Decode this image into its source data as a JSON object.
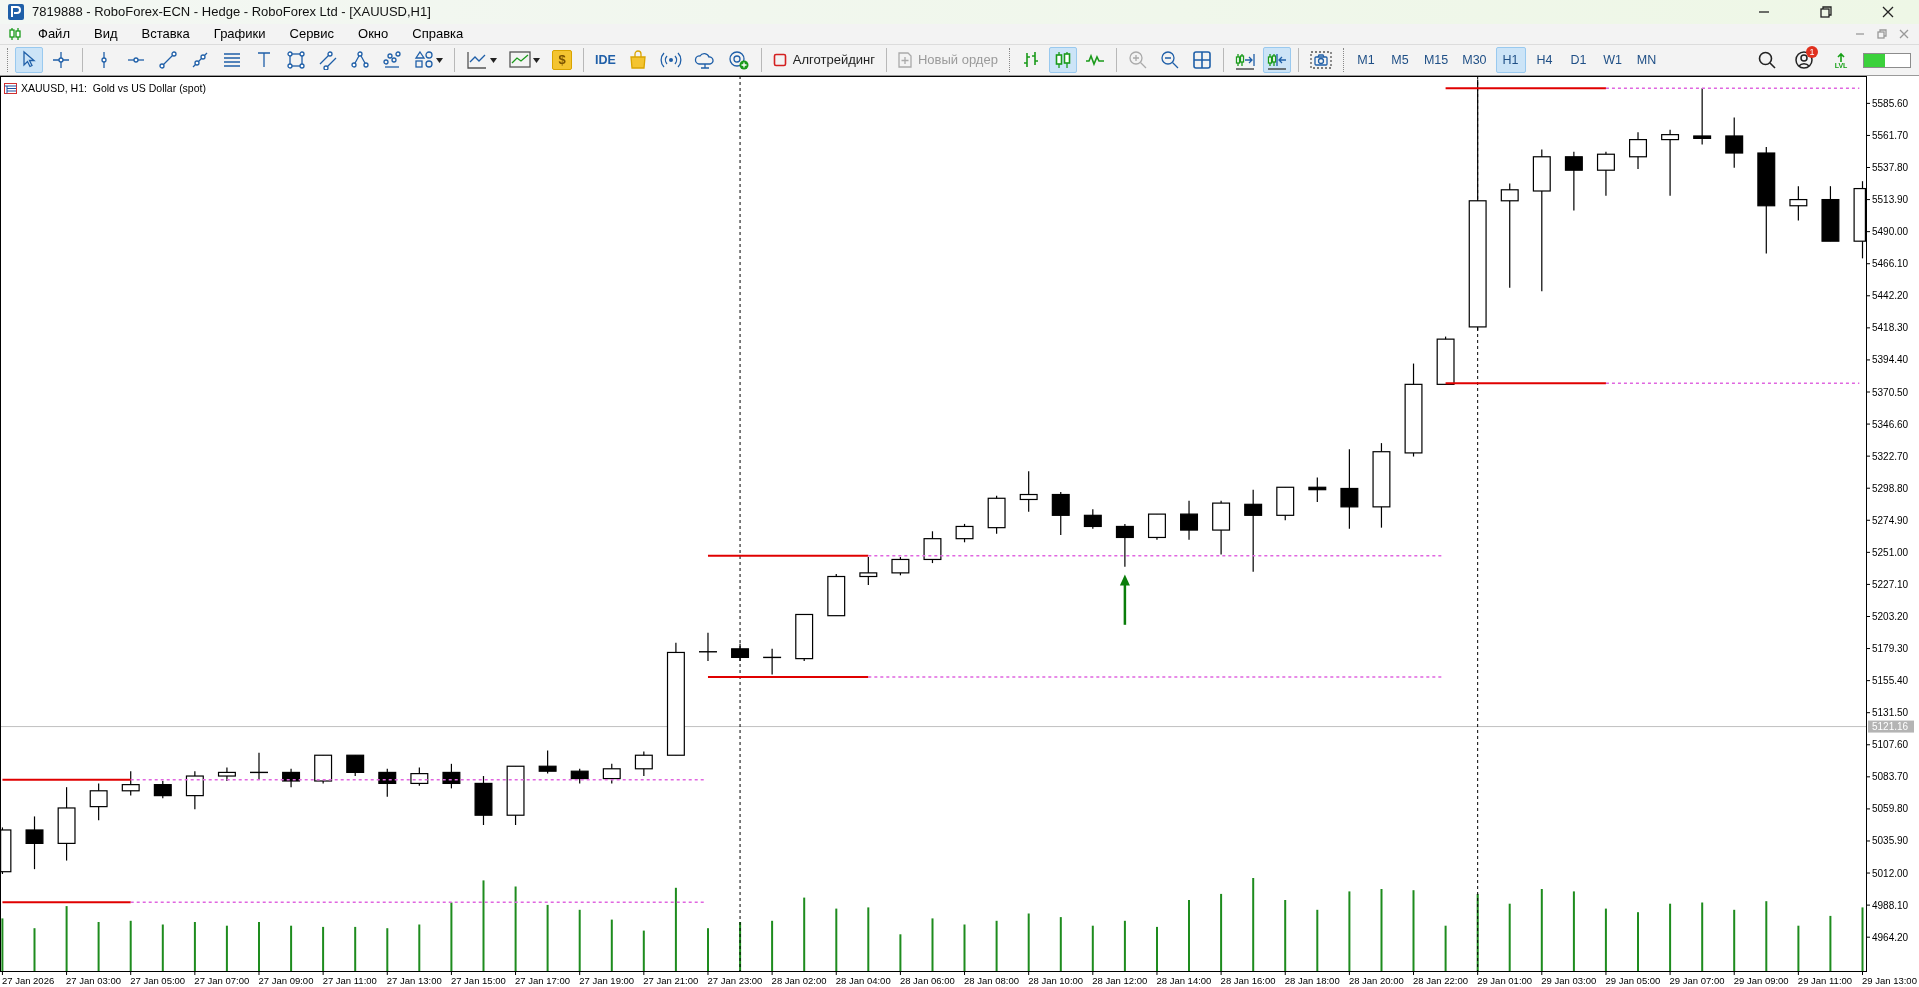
{
  "window": {
    "title": "7819888 - RoboForex-ECN - Hedge - RoboForex Ltd - [XAUUSD,H1]"
  },
  "menu": [
    "Файл",
    "Вид",
    "Вставка",
    "Графики",
    "Сервис",
    "Окно",
    "Справка"
  ],
  "toolbar": {
    "drawing_tools": [
      {
        "selected": true
      },
      {
        "selected": false
      },
      {
        "selected": false
      },
      {
        "selected": false
      },
      {
        "selected": false
      },
      {
        "selected": false
      },
      {
        "selected": false
      },
      {
        "selected": false
      },
      {
        "selected": false
      },
      {
        "selected": false
      },
      {
        "selected": false
      },
      {
        "selected": false
      },
      {
        "selected": false
      }
    ],
    "market_button": {
      "label": "$"
    },
    "ide_button": {
      "label": "IDE"
    },
    "algo_trading": {
      "label": "Алготрейдинг",
      "on": false
    },
    "new_order": {
      "label": "Новый ордер",
      "disabled": true
    },
    "chart_types": [
      {
        "selected": false
      },
      {
        "selected": true
      },
      {
        "selected": false
      }
    ],
    "scroll_tools": [
      {
        "selected": false
      },
      {
        "selected": true
      }
    ],
    "timeframes": [
      {
        "label": "M1",
        "selected": false
      },
      {
        "label": "M5",
        "selected": false
      },
      {
        "label": "M15",
        "selected": false
      },
      {
        "label": "M30",
        "selected": false
      },
      {
        "label": "H1",
        "selected": true
      },
      {
        "label": "H4",
        "selected": false
      },
      {
        "label": "D1",
        "selected": false
      },
      {
        "label": "W1",
        "selected": false
      },
      {
        "label": "MN",
        "selected": false
      }
    ],
    "notifications_badge": "1",
    "lvl_label": "LVL",
    "meter": {
      "level": 0.45
    }
  },
  "chart": {
    "title": "XAUUSD, H1:  Gold vs US Dollar (spot)",
    "price_labels": [
      "5585.60",
      "5561.70",
      "5537.80",
      "5513.90",
      "5490.00",
      "5466.10",
      "5442.20",
      "5418.30",
      "5394.40",
      "5370.50",
      "5346.60",
      "5322.70",
      "5298.80",
      "5274.90",
      "5251.00",
      "5227.10",
      "5203.20",
      "5179.30",
      "5155.40",
      "5131.50",
      "5107.60",
      "5083.70",
      "5059.80",
      "5035.90",
      "5012.00",
      "4988.10",
      "4964.20"
    ],
    "bid_label": "5121.16",
    "time_labels": [
      "27 Jan 2026",
      "27 Jan 03:00",
      "27 Jan 05:00",
      "27 Jan 07:00",
      "27 Jan 09:00",
      "27 Jan 11:00",
      "27 Jan 13:00",
      "27 Jan 15:00",
      "27 Jan 17:00",
      "27 Jan 19:00",
      "27 Jan 21:00",
      "27 Jan 23:00",
      "28 Jan 02:00",
      "28 Jan 04:00",
      "28 Jan 06:00",
      "28 Jan 08:00",
      "28 Jan 10:00",
      "28 Jan 12:00",
      "28 Jan 14:00",
      "28 Jan 16:00",
      "28 Jan 18:00",
      "28 Jan 20:00",
      "28 Jan 22:00",
      "29 Jan 01:00",
      "29 Jan 03:00",
      "29 Jan 05:00",
      "29 Jan 07:00",
      "29 Jan 09:00",
      "29 Jan 11:00",
      "29 Jan 13:00"
    ]
  }
}
